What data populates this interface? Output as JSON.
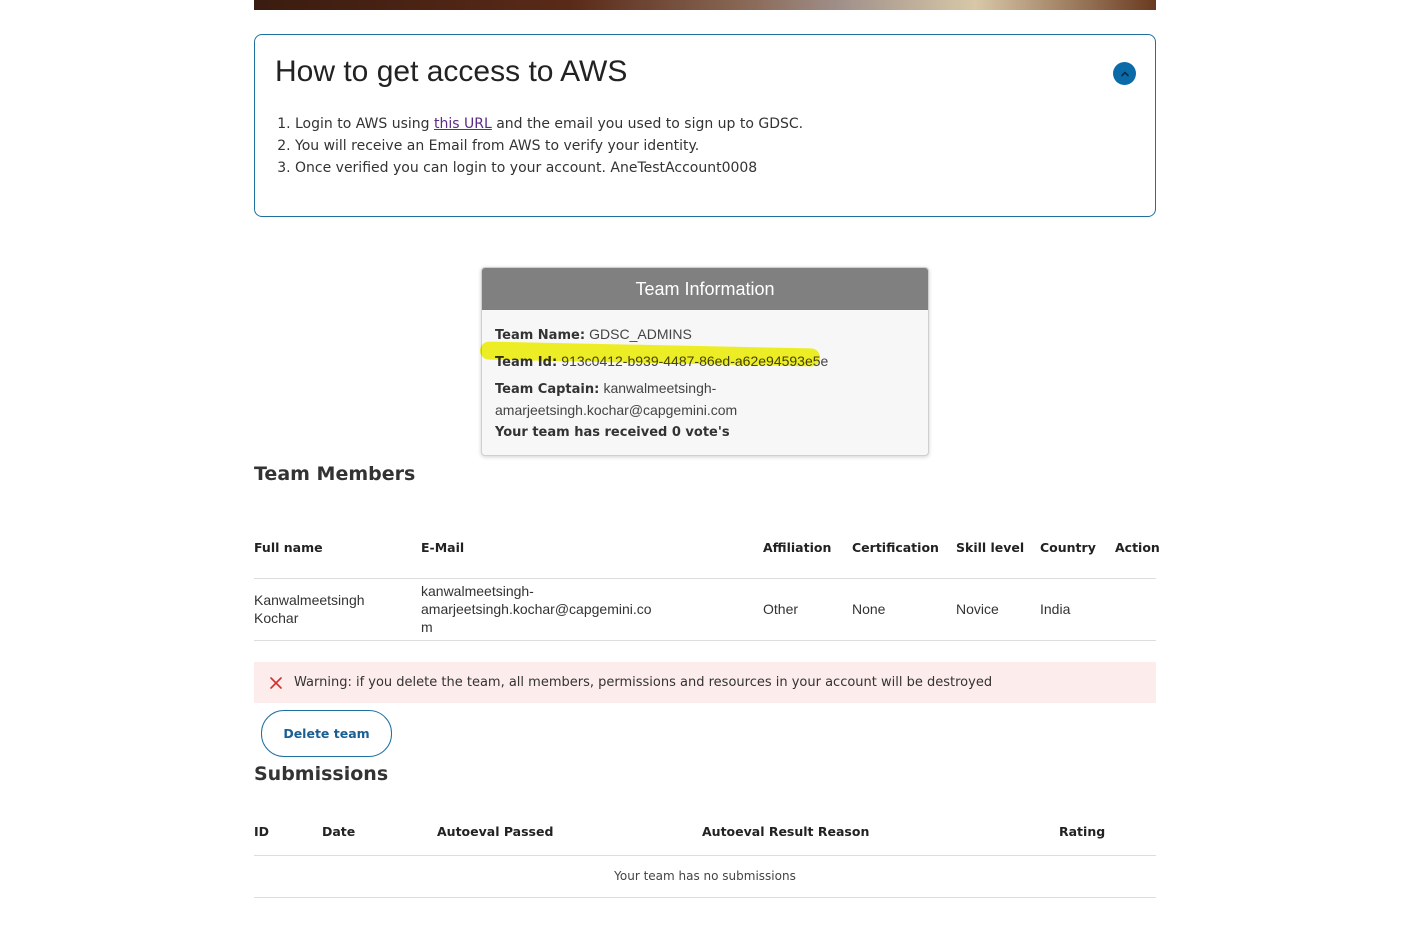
{
  "access": {
    "title": "How to get access to AWS",
    "step1_prefix": "Login to AWS using ",
    "step1_link": "this URL",
    "step1_suffix": " and the email you used to sign up to GDSC.",
    "step2": "You will receive an Email from AWS to verify your identity.",
    "step3": "Once verified you can login to your account. AneTestAccount0008"
  },
  "team_info": {
    "header": "Team Information",
    "name_label": "Team Name:",
    "name_value": "GDSC_ADMINS",
    "id_label": "Team Id:",
    "id_value": "913c0412-b939-4487-86ed-a62e94593e5e",
    "captain_label": "Team Captain:",
    "captain_value": "kanwalmeetsingh-amarjeetsingh.kochar@capgemini.com",
    "votes_text": "Your team has received 0 vote's"
  },
  "members": {
    "heading": "Team Members",
    "columns": [
      "Full name",
      "E-Mail",
      "Affiliation",
      "Certification",
      "Skill level",
      "Country",
      "Action"
    ],
    "rows": [
      {
        "full_name": "Kanwalmeetsingh Kochar",
        "email": "kanwalmeetsingh-amarjeetsingh.kochar@capgemini.com",
        "affiliation": "Other",
        "certification": "None",
        "skill_level": "Novice",
        "country": "India",
        "action": ""
      }
    ]
  },
  "warning": {
    "text": "Warning: if you delete the team, all members, permissions and resources in your account will be destroyed"
  },
  "delete_button": "Delete team",
  "submissions": {
    "heading": "Submissions",
    "columns": [
      "ID",
      "Date",
      "Autoeval Passed",
      "Autoeval Result Reason",
      "Rating"
    ],
    "empty_text": "Your team has no submissions"
  },
  "colors": {
    "accent": "#0a6ba8",
    "border": "#1f6f9f",
    "link": "#5b2a86",
    "warning_bg": "#fdecec",
    "warning_icon": "#d32f2f",
    "highlight": "#f4f400"
  }
}
